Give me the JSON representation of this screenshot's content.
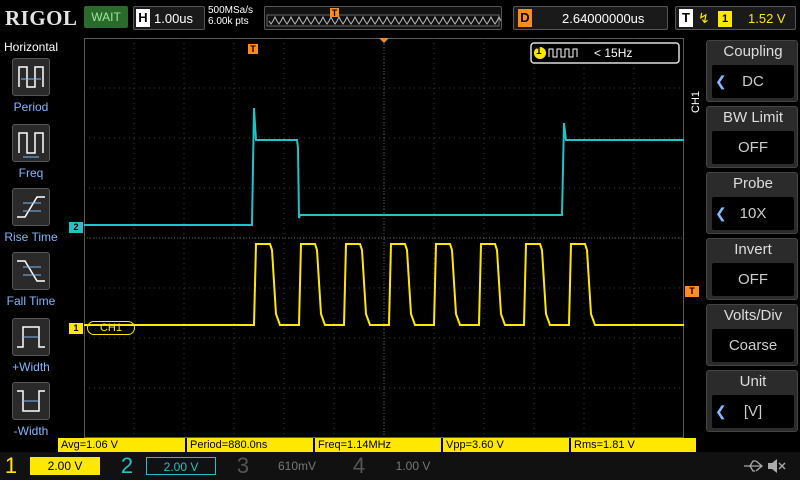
{
  "topbar": {
    "logo": "RIGOL",
    "status": "WAIT",
    "horizontal_label": "H",
    "horizontal_value": "1.00us",
    "sample_rate": "500MSa/s",
    "memory_depth": "6.00k pts",
    "delay_label": "D",
    "delay_value": "2.64000000us",
    "trigger_label": "T",
    "trigger_channel": "1",
    "trigger_level": "1.52 V"
  },
  "left_menu": {
    "title": "Horizontal",
    "items": [
      {
        "label": "Period",
        "icon": "period-icon"
      },
      {
        "label": "Freq",
        "icon": "freq-icon"
      },
      {
        "label": "Rise Time",
        "icon": "rise-time-icon"
      },
      {
        "label": "Fall Time",
        "icon": "fall-time-icon"
      },
      {
        "label": "+Width",
        "icon": "positive-width-icon"
      },
      {
        "label": "-Width",
        "icon": "negative-width-icon"
      }
    ]
  },
  "counter": {
    "channel": "1",
    "text": "< 15Hz"
  },
  "grid_markers": {
    "ch1_label": "CH1",
    "ch1_marker": "1",
    "ch2_marker": "2",
    "trigger_marker": "T"
  },
  "right_menu": {
    "channel_tab": "CH1",
    "items": [
      {
        "title": "Coupling",
        "value": "DC",
        "has_arrow": true
      },
      {
        "title": "BW Limit",
        "value": "OFF",
        "has_arrow": false
      },
      {
        "title": "Probe",
        "value": "10X",
        "has_arrow": true
      },
      {
        "title": "Invert",
        "value": "OFF",
        "has_arrow": false
      },
      {
        "title": "Volts/Div",
        "value": "Coarse",
        "has_arrow": false
      },
      {
        "title": "Unit",
        "value": "[V]",
        "has_arrow": true
      }
    ]
  },
  "measurements": [
    {
      "text": "Avg=1.06 V"
    },
    {
      "text": "Period=880.0ns"
    },
    {
      "text": "Freq=1.14MHz"
    },
    {
      "text": "Vpp=3.60 V"
    },
    {
      "text": "Rms=1.81 V"
    }
  ],
  "channels": [
    {
      "number": "1",
      "scale": "2.00 V",
      "color": "#ffe800",
      "active": true
    },
    {
      "number": "2",
      "scale": "2.00 V",
      "color": "#1fc4c4",
      "active": false
    },
    {
      "number": "3",
      "scale": "610mV",
      "color": "#cc44cc",
      "active": false
    },
    {
      "number": "4",
      "scale": "1.00 V",
      "color": "#4a7ad0",
      "active": false
    }
  ],
  "colors": {
    "ch1": "#ffe800",
    "ch2": "#1fc4c4",
    "delay": "#ff8c1a",
    "grid": "#4a4a4a"
  }
}
